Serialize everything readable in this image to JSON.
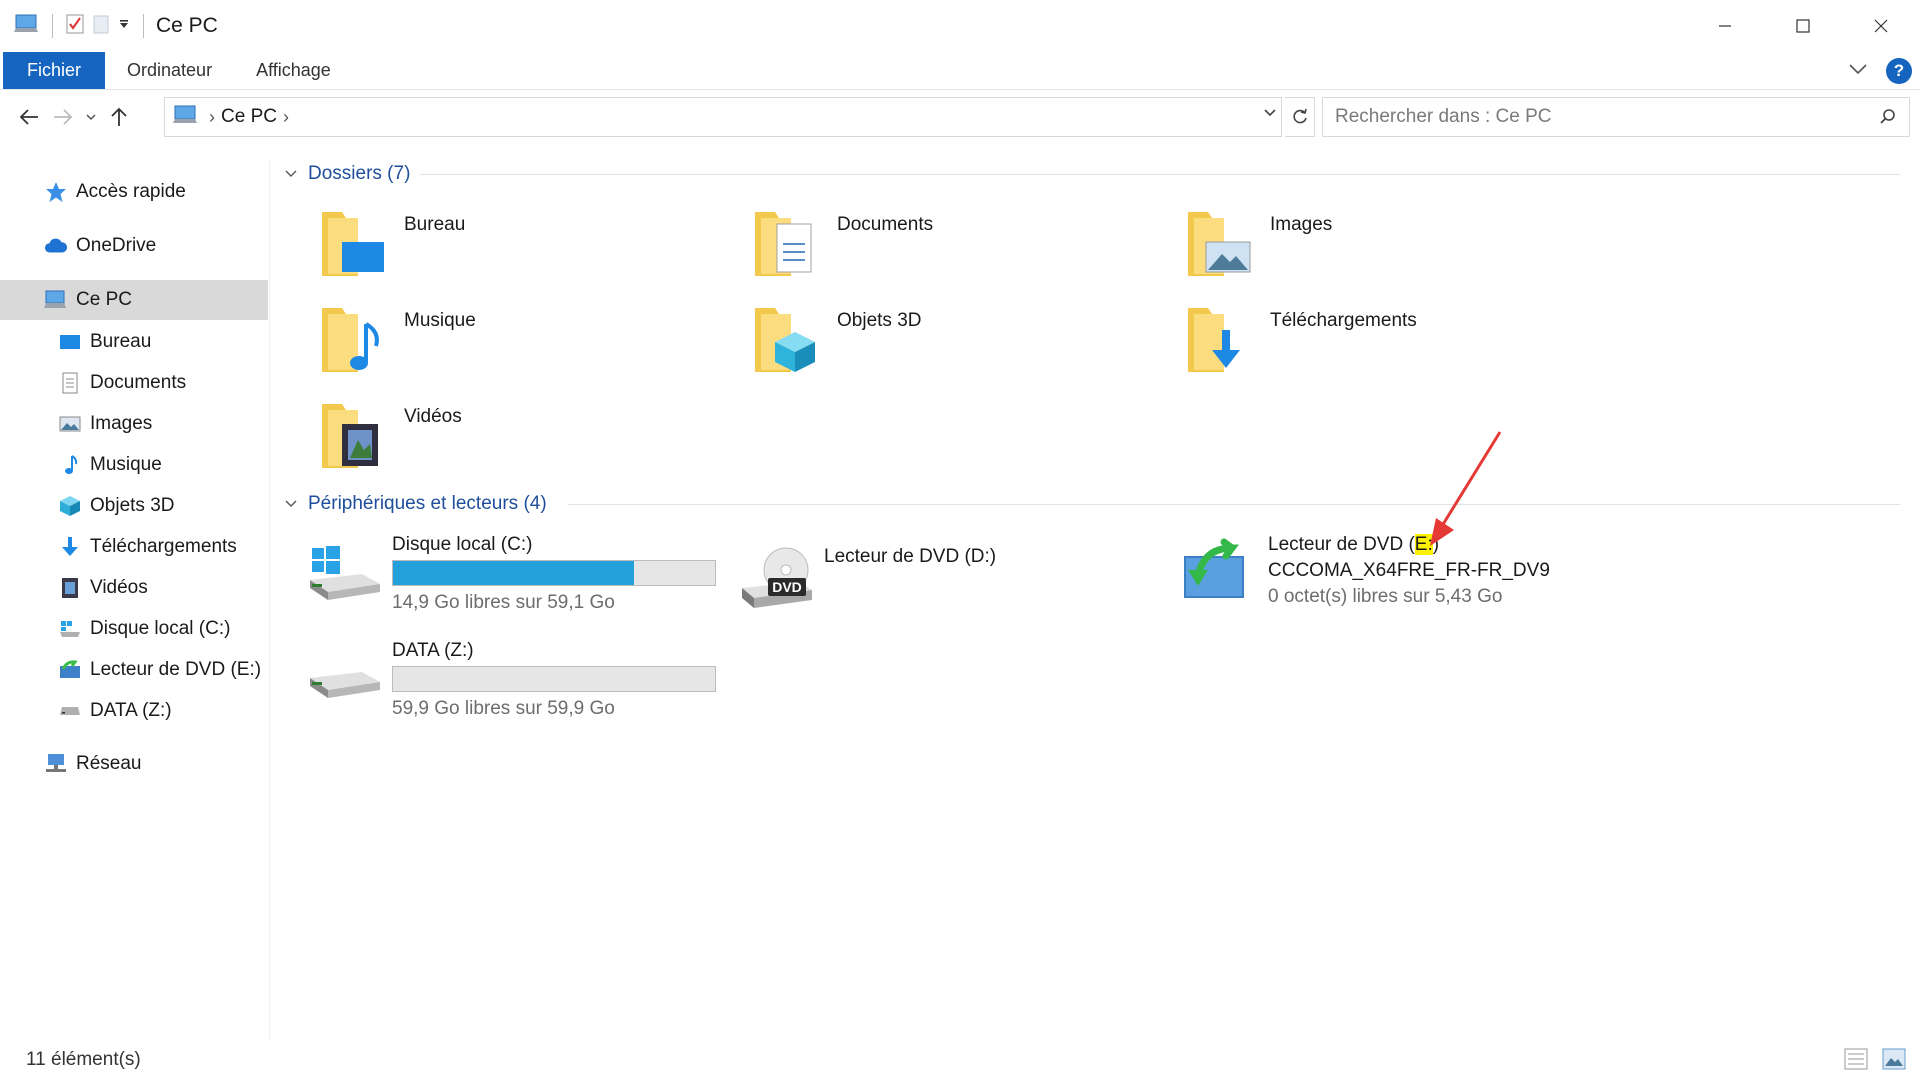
{
  "window": {
    "title": "Ce PC",
    "controls": {
      "minimize": "–",
      "maximize": "☐",
      "close": "✕"
    }
  },
  "ribbon": {
    "tabs": [
      "Fichier",
      "Ordinateur",
      "Affichage"
    ],
    "help": "?"
  },
  "navigation": {
    "back_icon": "arrow-left-icon",
    "forward_icon": "arrow-right-icon",
    "up_icon": "arrow-up-icon",
    "address": {
      "crumb": "Ce PC"
    },
    "search": {
      "placeholder": "Rechercher dans : Ce PC"
    }
  },
  "sidebar": {
    "items": [
      {
        "label": "Accès rapide",
        "icon": "star-icon"
      },
      {
        "label": "OneDrive",
        "icon": "cloud-icon"
      },
      {
        "label": "Ce PC",
        "icon": "computer-icon",
        "selected": true
      },
      {
        "label": "Bureau",
        "icon": "desktop-icon"
      },
      {
        "label": "Documents",
        "icon": "document-icon"
      },
      {
        "label": "Images",
        "icon": "image-icon"
      },
      {
        "label": "Musique",
        "icon": "music-icon"
      },
      {
        "label": "Objets 3D",
        "icon": "cube-icon"
      },
      {
        "label": "Téléchargements",
        "icon": "download-icon"
      },
      {
        "label": "Vidéos",
        "icon": "video-icon"
      },
      {
        "label": "Disque local (C:)",
        "icon": "drive-icon"
      },
      {
        "label": "Lecteur de DVD (E:)",
        "icon": "dvd-install-icon"
      },
      {
        "label": "DATA (Z:)",
        "icon": "drive-icon"
      },
      {
        "label": "Réseau",
        "icon": "network-icon"
      }
    ]
  },
  "folders_group": {
    "title": "Dossiers (7)",
    "items": [
      {
        "label": "Bureau",
        "icon": "folder-desktop-icon"
      },
      {
        "label": "Documents",
        "icon": "folder-documents-icon"
      },
      {
        "label": "Images",
        "icon": "folder-images-icon"
      },
      {
        "label": "Musique",
        "icon": "folder-music-icon"
      },
      {
        "label": "Objets 3D",
        "icon": "folder-3d-icon"
      },
      {
        "label": "Téléchargements",
        "icon": "folder-download-icon"
      },
      {
        "label": "Vidéos",
        "icon": "folder-video-icon"
      }
    ]
  },
  "devices_group": {
    "title": "Périphériques et lecteurs (4)",
    "drives": [
      {
        "name": "Disque local (C:)",
        "free": "14,9 Go libres sur 59,1 Go",
        "used_fraction": 0.748,
        "icon": "windows-drive-icon"
      },
      {
        "name": "Lecteur de DVD (D:)",
        "icon": "dvd-drive-icon",
        "badge": "DVD"
      },
      {
        "name_prefix": "Lecteur de DVD (",
        "name_highlight": "E:",
        "name_suffix": ")",
        "volume": "CCCOMA_X64FRE_FR-FR_DV9",
        "free": "0 octet(s) libres sur 5,43 Go",
        "icon": "dvd-install-icon"
      },
      {
        "name": "DATA (Z:)",
        "free": "59,9 Go libres sur 59,9 Go",
        "used_fraction": 0.0,
        "icon": "drive-icon"
      }
    ]
  },
  "status": {
    "count": "11 élément(s)"
  },
  "colors": {
    "accent": "#1565c0",
    "bar_fill": "#26a0da",
    "annotation_arrow": "#e53935",
    "highlight": "#fff200"
  }
}
